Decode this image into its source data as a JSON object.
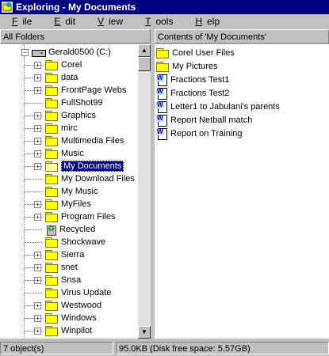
{
  "window": {
    "title": "Exploring - My Documents"
  },
  "menu": [
    {
      "label": "File"
    },
    {
      "label": "Edit"
    },
    {
      "label": "View"
    },
    {
      "label": "Tools"
    },
    {
      "label": "Help"
    }
  ],
  "left_pane": {
    "header": "All Folders"
  },
  "right_pane": {
    "header": "Contents of 'My Documents'"
  },
  "tree": {
    "drive": {
      "label": "Gerald0500 (C:)",
      "icon": "drive-icon"
    },
    "folders": [
      {
        "label": "Corel",
        "expandable": true
      },
      {
        "label": "data",
        "expandable": true
      },
      {
        "label": "FrontPage Webs",
        "expandable": true
      },
      {
        "label": "FullShot99",
        "expandable": false
      },
      {
        "label": "Graphics",
        "expandable": true
      },
      {
        "label": "mirc",
        "expandable": true
      },
      {
        "label": "Multimedia Files",
        "expandable": true
      },
      {
        "label": "Music",
        "expandable": true
      },
      {
        "label": "My Documents",
        "expandable": true,
        "selected": true
      },
      {
        "label": "My Download Files",
        "expandable": false
      },
      {
        "label": "My Music",
        "expandable": false
      },
      {
        "label": "MyFiles",
        "expandable": true
      },
      {
        "label": "Program Files",
        "expandable": true
      },
      {
        "label": "Recycled",
        "expandable": false,
        "icon": "recycle-bin-icon"
      },
      {
        "label": "Shockwave",
        "expandable": false
      },
      {
        "label": "Sierra",
        "expandable": true
      },
      {
        "label": "snet",
        "expandable": true
      },
      {
        "label": "Snsa",
        "expandable": true
      },
      {
        "label": "Virus Update",
        "expandable": false
      },
      {
        "label": "Westwood",
        "expandable": true
      },
      {
        "label": "Windows",
        "expandable": true
      },
      {
        "label": "Winpilot",
        "expandable": true
      }
    ]
  },
  "files": [
    {
      "label": "Corel User Files",
      "type": "folder"
    },
    {
      "label": "My Pictures",
      "type": "folder"
    },
    {
      "label": "Fractions Test1",
      "type": "document"
    },
    {
      "label": "Fractions Test2",
      "type": "document"
    },
    {
      "label": "Letter1 to Jabulani's parents",
      "type": "document"
    },
    {
      "label": "Report Netball match",
      "type": "document"
    },
    {
      "label": "Report on Training",
      "type": "document"
    }
  ],
  "status": {
    "objects": "7 object(s)",
    "disk": "95.0KB (Disk free space: 5.57GB)"
  },
  "colors": {
    "titlebar": "#000080",
    "selection": "#000080",
    "folder": "#ffff00",
    "chrome": "#c0c0c0"
  }
}
